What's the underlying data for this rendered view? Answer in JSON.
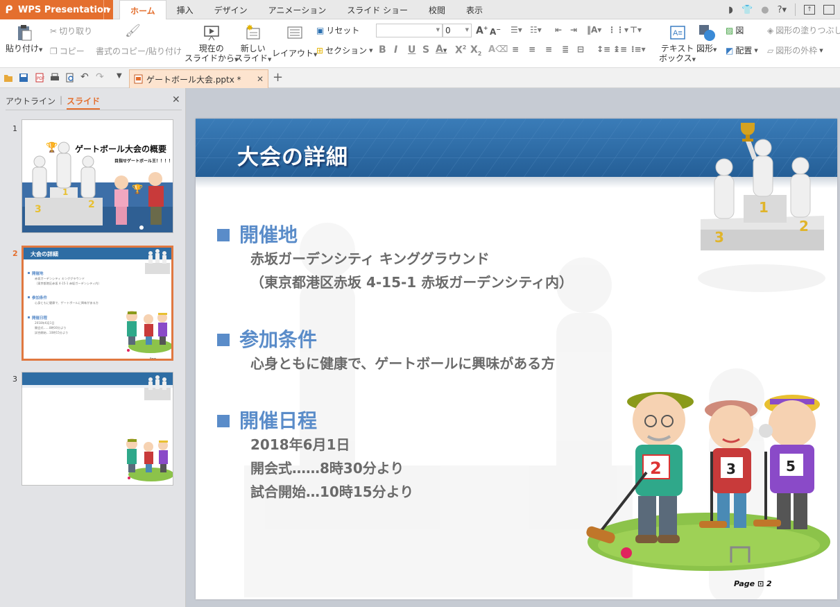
{
  "app": {
    "name": "WPS Presentation"
  },
  "menu_tabs": [
    "ホーム",
    "挿入",
    "デザイン",
    "アニメーション",
    "スライド ショー",
    "校閲",
    "表示"
  ],
  "ribbon": {
    "paste": "貼り付け",
    "cut": "切り取り",
    "copy": "コピー",
    "format_painter": "書式のコピー/貼り付け",
    "from_current_1": "現在の",
    "from_current_2": "スライドから",
    "new_slide_1": "新しい",
    "new_slide_2": "スライド",
    "layout": "レイアウト",
    "reset": "リセット",
    "section": "セクション",
    "font_name": "",
    "font_size": "0",
    "textbox_1": "テキスト",
    "textbox_2": "ボックス",
    "shape": "図形",
    "picture": "図",
    "arrange": "配置",
    "shape_fill": "図形の塗りつぶし",
    "shape_outline": "図形の外枠"
  },
  "document": {
    "tab_title": "ゲートボール大会.pptx *"
  },
  "left_pane": {
    "tab_outline": "アウトライン",
    "tab_slides": "スライド",
    "slide_numbers": [
      "1",
      "2",
      "3"
    ]
  },
  "thumb1": {
    "title": "ゲートボール大会の概要",
    "subtitle": "目指せゲートボール王！！！！",
    "num_left": "3",
    "num_mid": "2",
    "num_right": "1"
  },
  "thumb2": {
    "title": "大会の詳細",
    "lines": [
      "開催地",
      "赤坂ガーデンシティ キンググラウンド",
      "（東京都港区赤坂 4-15-1 赤坂ガーデンシティ内）",
      "参加条件",
      "心身ともに健康で、ゲートボールに興味がある方",
      "開催日程",
      "2018年6月1日",
      "開会式……8時30分より",
      "試合開始…10時15分より"
    ]
  },
  "slide": {
    "title": "大会の詳細",
    "section1": {
      "heading": "開催地",
      "line1": "赤坂ガーデンシティ キンググラウンド",
      "line2": "（東京都港区赤坂 4-15-1 赤坂ガーデンシティ内）"
    },
    "section2": {
      "heading": "参加条件",
      "line1": "心身ともに健康で、ゲートボールに興味がある方"
    },
    "section3": {
      "heading": "開催日程",
      "line1": "2018年6月1日",
      "line2": "開会式……8時30分より",
      "line3": "試合開始…10時15分より"
    },
    "podium_numbers": {
      "first": "1",
      "second": "2",
      "third": "3"
    },
    "player_numbers": [
      "2",
      "3",
      "5"
    ],
    "page_label": "Page ⊡ 2"
  },
  "colors": {
    "accent": "#e46f2e",
    "heading_blue": "#5a8cc9",
    "banner_blue": "#2e6da4",
    "body_gray": "#6a6a6a"
  }
}
